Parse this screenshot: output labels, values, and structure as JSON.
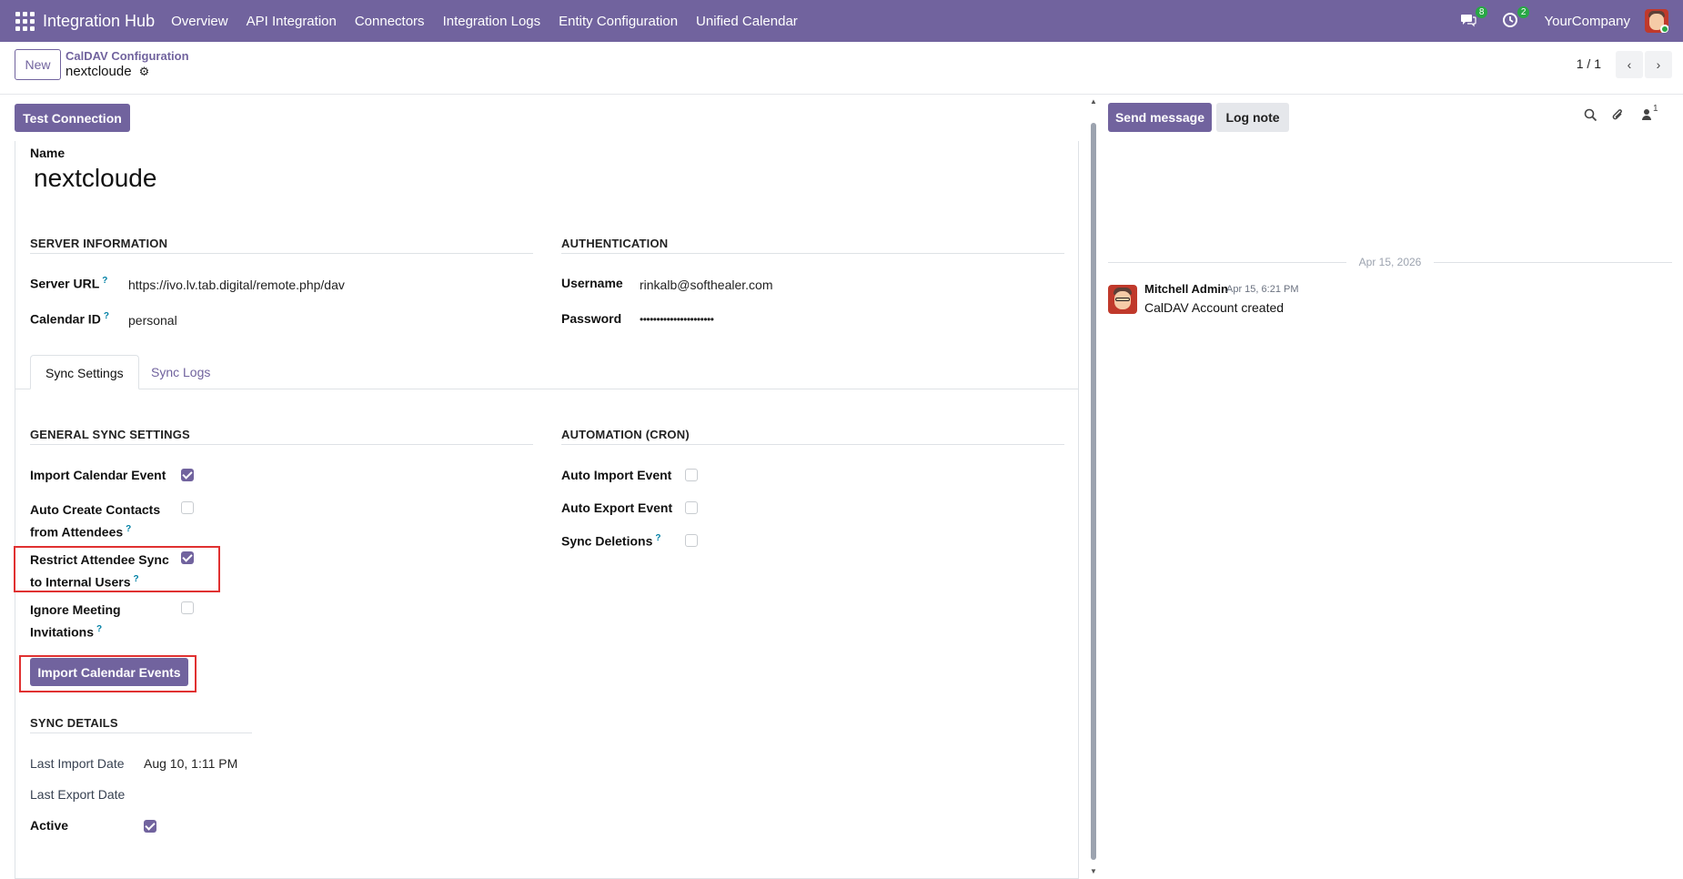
{
  "navbar": {
    "brand": "Integration Hub",
    "menu": [
      "Overview",
      "API Integration",
      "Connectors",
      "Integration Logs",
      "Entity Configuration",
      "Unified Calendar"
    ],
    "messages_count": "8",
    "activities_count": "2",
    "company": "YourCompany"
  },
  "control": {
    "new_label": "New",
    "breadcrumb_parent": "CalDAV Configuration",
    "breadcrumb_current": "nextcloude",
    "pager": "1 / 1"
  },
  "form": {
    "test_connection_label": "Test Connection",
    "name_label": "Name",
    "name_value": "nextcloude",
    "server_section": "SERVER INFORMATION",
    "auth_section": "AUTHENTICATION",
    "server_url_label": "Server URL",
    "server_url_value": "https://ivo.lv.tab.digital/remote.php/dav",
    "calendar_id_label": "Calendar ID",
    "calendar_id_value": "personal",
    "username_label": "Username",
    "username_value": "rinkalb@softhealer.com",
    "password_label": "Password",
    "password_value": "••••••••••••••••••••••",
    "help_mark": "?",
    "tabs": [
      "Sync Settings",
      "Sync Logs"
    ],
    "general_section": "GENERAL SYNC SETTINGS",
    "automation_section": "AUTOMATION (CRON)",
    "import_event_label": "Import Calendar Event",
    "import_event_checked": true,
    "auto_create_label_1": "Auto Create Contacts",
    "auto_create_label_2": "from Attendees",
    "auto_create_checked": false,
    "restrict_label_1": "Restrict Attendee Sync",
    "restrict_label_2": "to Internal Users",
    "restrict_checked": true,
    "ignore_label_1": "Ignore Meeting",
    "ignore_label_2": "Invitations",
    "ignore_checked": false,
    "auto_import_label": "Auto Import Event",
    "auto_import_checked": false,
    "auto_export_label": "Auto Export Event",
    "auto_export_checked": false,
    "sync_deletions_label": "Sync Deletions",
    "sync_deletions_checked": false,
    "import_events_button": "Import Calendar Events",
    "sync_details_section": "SYNC DETAILS",
    "last_import_label": "Last Import Date",
    "last_import_value": "Aug 10, 1:11 PM",
    "last_export_label": "Last Export Date",
    "last_export_value": "",
    "active_label": "Active",
    "active_checked": true
  },
  "chatter": {
    "send_message_label": "Send message",
    "log_note_label": "Log note",
    "followers_count": "1",
    "date_separator": "Apr 15, 2026",
    "message": {
      "author": "Mitchell Admin",
      "time": "Apr 15, 6:21 PM",
      "body": "CalDAV Account created"
    }
  },
  "colors": {
    "brand": "#71639e",
    "highlight": "#e03131",
    "badge": "#28a745"
  }
}
